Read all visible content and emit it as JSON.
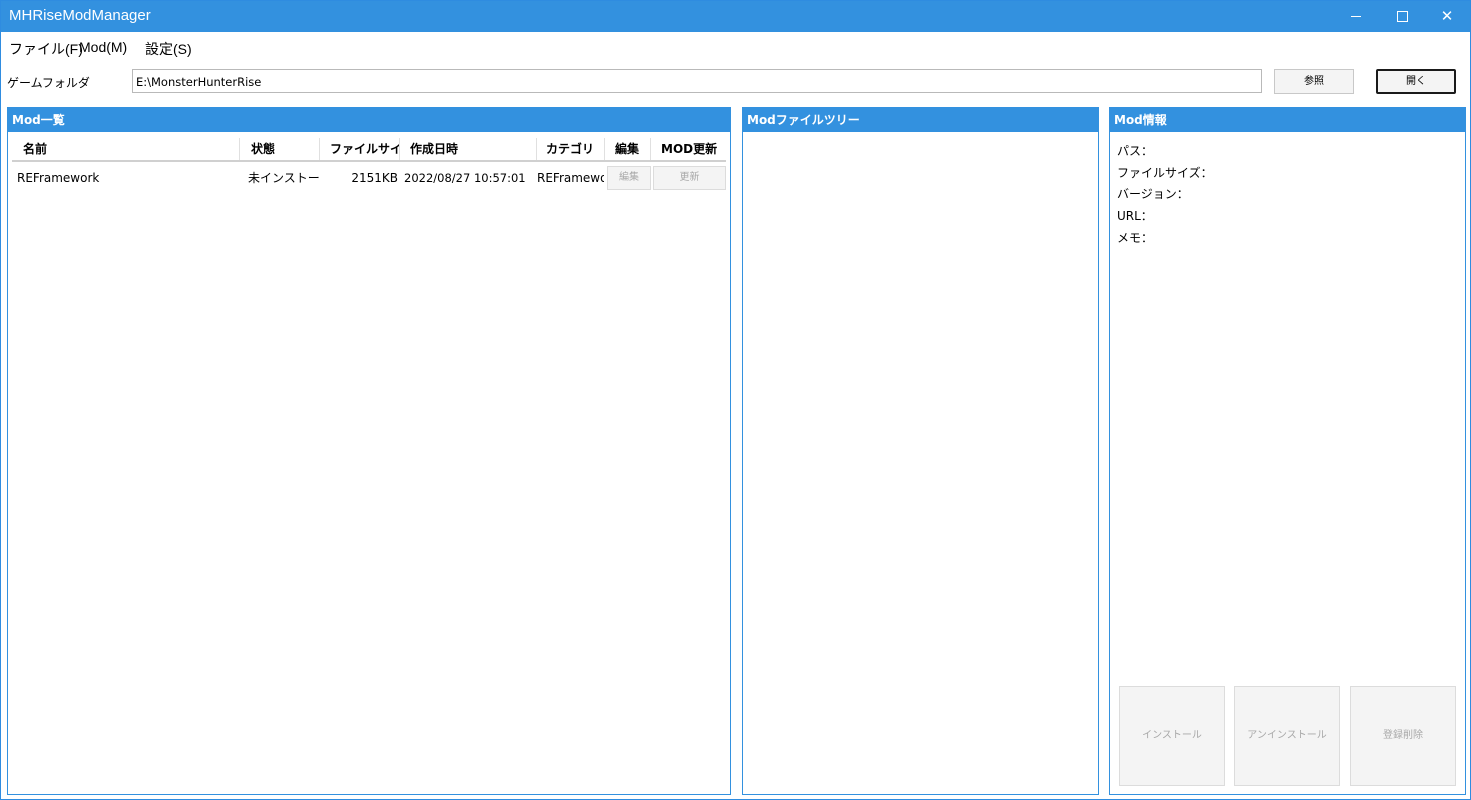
{
  "window": {
    "title": "MHRiseModManager"
  },
  "menu": {
    "items": [
      "ファイル(F)",
      "Mod(M)",
      "設定(S)"
    ]
  },
  "gamefolder": {
    "label": "ゲームフォルダ",
    "value": "E:\\MonsterHunterRise",
    "browse_label": "参照",
    "open_label": "開く"
  },
  "modlist": {
    "header": "Mod一覧",
    "columns": [
      "名前",
      "状態",
      "ファイルサイズ",
      "作成日時",
      "カテゴリ",
      "編集",
      "MOD更新"
    ],
    "rows": [
      {
        "name": "REFramework",
        "status": "未インストール",
        "size": "2151KB",
        "date": "2022/08/27 10:57:01",
        "category": "REFramework",
        "edit_label": "編集",
        "update_label": "更新"
      }
    ]
  },
  "tree": {
    "header": "Modファイルツリー"
  },
  "info": {
    "header": "Mod情報",
    "fields": [
      "パス：",
      "ファイルサイズ：",
      "バージョン：",
      "URL：",
      "メモ："
    ],
    "buttons": [
      "インストール",
      "アンインストール",
      "登録削除"
    ]
  }
}
